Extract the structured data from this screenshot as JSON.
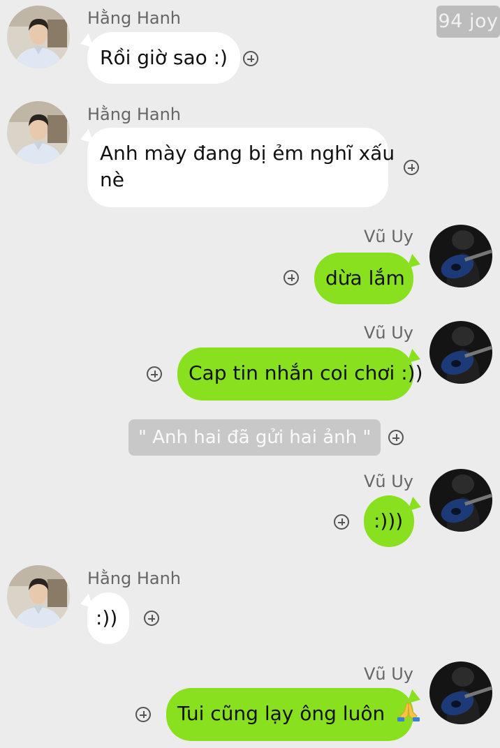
{
  "watermark": "94 joy",
  "messages": [
    {
      "sender": "Hằng Hanh",
      "text": "Rồi giờ sao :)"
    },
    {
      "sender": "Hằng Hanh",
      "text_line1": "Anh mày đang bị ẻm nghĩ xấu",
      "text_line2": "nè"
    },
    {
      "sender": "Vũ Uy",
      "text": "dừa lắm"
    },
    {
      "sender": "Vũ Uy",
      "text": "Cap tin nhắn coi chơi :))"
    },
    {
      "system": "\" Anh hai đã gửi hai ảnh \""
    },
    {
      "sender": "Vũ Uy",
      "text": ":)))"
    },
    {
      "sender": "Hằng Hanh",
      "text": ":))"
    },
    {
      "sender": "Vũ Uy",
      "text": "Tui cũng lạy ông luôn",
      "emoji": "folded-hands-emoji"
    }
  ],
  "colors": {
    "background": "#ececec",
    "incoming_bubble": "#ffffff",
    "outgoing_bubble": "#88e01e",
    "system_bubble": "#c8c8c8"
  }
}
